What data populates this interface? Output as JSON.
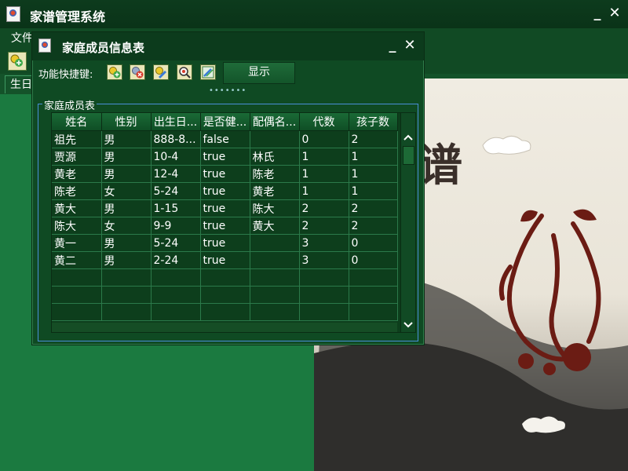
{
  "app": {
    "title": "家谱管理系统",
    "menu": [
      "文件"
    ],
    "tab_label": "生日"
  },
  "window_controls": {
    "minimize": "_",
    "close": "✕"
  },
  "background_picture": {
    "characters": "谱",
    "description_icon": "phoenix-papercut-icon"
  },
  "inner_window": {
    "title": "家庭成员信息表",
    "shortcut_label": "功能快捷键:",
    "shortcut_icons": [
      "add-member-icon",
      "delete-member-icon",
      "edit-member-icon",
      "search-member-icon",
      "annotate-icon"
    ],
    "show_button": "显示",
    "drag_handle": "•••••••",
    "group_title": "家庭成员表"
  },
  "table": {
    "columns": [
      "姓名",
      "性别",
      "出生日...",
      "是否健...",
      "配偶名...",
      "代数",
      "孩子数"
    ],
    "rows": [
      [
        "祖先",
        "男",
        "888-8...",
        "false",
        "",
        "0",
        "2"
      ],
      [
        "贾源",
        "男",
        "10-4",
        "true",
        "林氏",
        "1",
        "1"
      ],
      [
        "黄老",
        "男",
        "12-4",
        "true",
        "陈老",
        "1",
        "1"
      ],
      [
        "陈老",
        "女",
        "5-24",
        "true",
        "黄老",
        "1",
        "1"
      ],
      [
        "黄大",
        "男",
        "1-15",
        "true",
        "陈大",
        "2",
        "2"
      ],
      [
        "陈大",
        "女",
        "9-9",
        "true",
        "黄大",
        "2",
        "2"
      ],
      [
        "黄一",
        "男",
        "5-24",
        "true",
        "",
        "3",
        "0"
      ],
      [
        "黄二",
        "男",
        "2-24",
        "true",
        "",
        "3",
        "0"
      ]
    ],
    "empty_rows": 3
  },
  "colors": {
    "frame_green": "#0f4a23",
    "panel_green": "#1b7a40",
    "group_border": "#4a8ed8",
    "papercut_red": "#6b1c14"
  }
}
